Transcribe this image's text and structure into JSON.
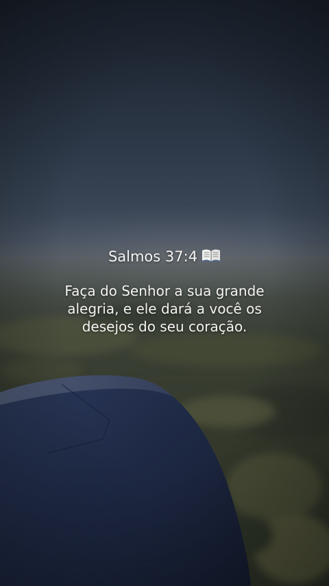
{
  "post": {
    "reference": "Salmos 37:4",
    "reference_icon": "open-book-icon",
    "verse_lines": [
      "Faça do Senhor a sua grande",
      "alegria, e ele dará a você os",
      "desejos do seu coração."
    ]
  },
  "colors": {
    "text": "#f4f4f2",
    "sky_top": "#1a212c",
    "horizon": "#545b62",
    "ground": "#383d31",
    "engine": "#1f2a44"
  }
}
